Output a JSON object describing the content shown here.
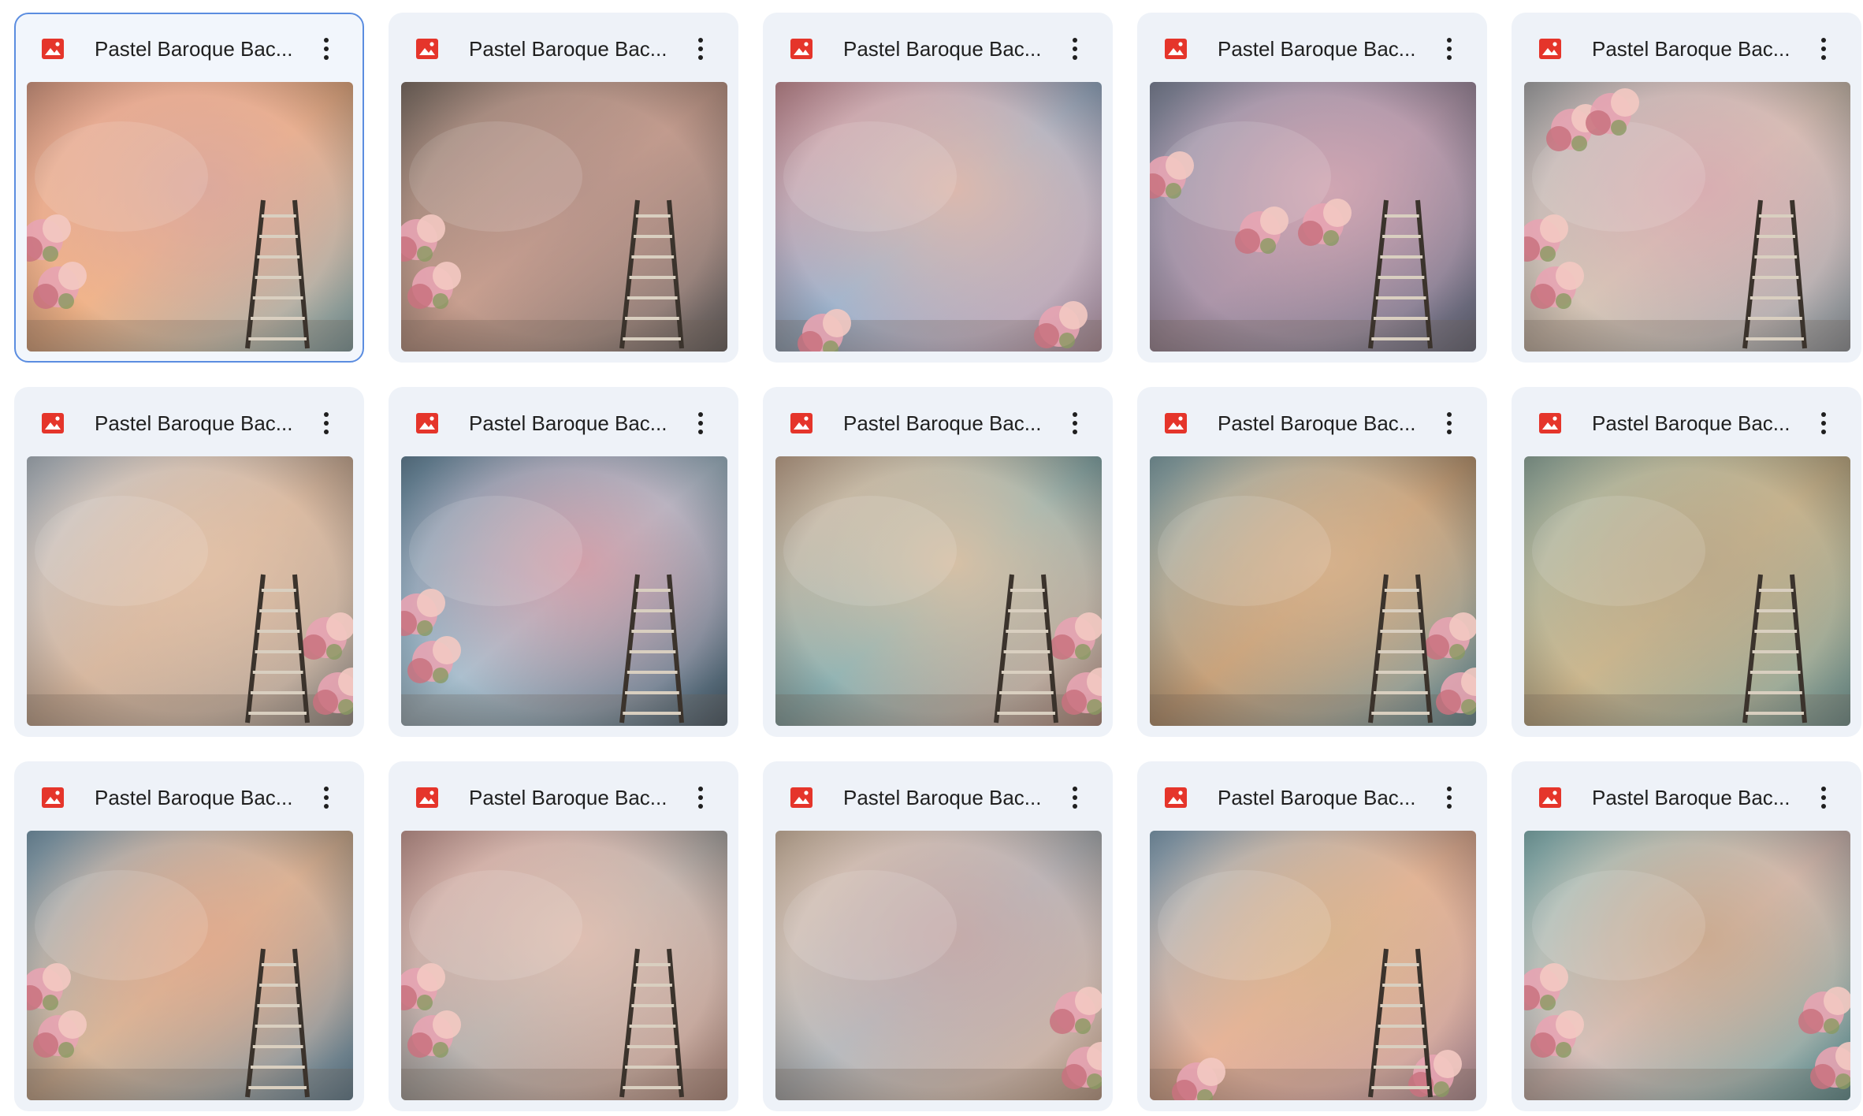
{
  "files": [
    {
      "title": "Pastel Baroque Bac...",
      "icon": "image-file-icon",
      "selected": true,
      "palette": [
        "#e8a890",
        "#f2b58a",
        "#8fb3b8",
        "#d8a7a0"
      ],
      "ladder": true,
      "flowers": "bottom-left"
    },
    {
      "title": "Pastel Baroque Bac...",
      "icon": "image-file-icon",
      "selected": false,
      "palette": [
        "#8a7a70",
        "#c9a090",
        "#6f6a6a",
        "#b5938a"
      ],
      "ladder": true,
      "flowers": "left"
    },
    {
      "title": "Pastel Baroque Bac...",
      "icon": "image-file-icon",
      "selected": false,
      "palette": [
        "#d89aa0",
        "#9fb5cf",
        "#c7a5b5",
        "#e6b9a8"
      ],
      "ladder": false,
      "flowers": "bottom"
    },
    {
      "title": "Pastel Baroque Bac...",
      "icon": "image-file-icon",
      "selected": false,
      "palette": [
        "#8c93a8",
        "#a994a8",
        "#6f7388",
        "#d7a9b4"
      ],
      "ladder": true,
      "flowers": "top"
    },
    {
      "title": "Pastel Baroque Bac...",
      "icon": "image-file-icon",
      "selected": false,
      "palette": [
        "#b7b6b8",
        "#d7c7b8",
        "#9fa7b0",
        "#d8a9b0"
      ],
      "ladder": true,
      "flowers": "top-left"
    },
    {
      "title": "Pastel Baroque Bac...",
      "icon": "image-file-icon",
      "selected": false,
      "palette": [
        "#bfc9d3",
        "#d6b79f",
        "#a9a19a",
        "#e3c2a8"
      ],
      "ladder": true,
      "flowers": "right"
    },
    {
      "title": "Pastel Baroque Bac...",
      "icon": "image-file-icon",
      "selected": false,
      "palette": [
        "#6f8fa5",
        "#a9c2d1",
        "#4e6475",
        "#d99aa3"
      ],
      "ladder": true,
      "flowers": "left"
    },
    {
      "title": "Pastel Baroque Bac...",
      "icon": "image-file-icon",
      "selected": false,
      "palette": [
        "#d5b59b",
        "#8fb4b5",
        "#c89e8f",
        "#e2c2a3"
      ],
      "ladder": true,
      "flowers": "right"
    },
    {
      "title": "Pastel Baroque Bac...",
      "icon": "image-file-icon",
      "selected": false,
      "palette": [
        "#8fb1b8",
        "#c7a17a",
        "#6f9aa6",
        "#d8b48f"
      ],
      "ladder": true,
      "flowers": "right"
    },
    {
      "title": "Pastel Baroque Bac...",
      "icon": "image-file-icon",
      "selected": false,
      "palette": [
        "#9fb9ac",
        "#cdb88f",
        "#7ea5a2",
        "#b9a88a"
      ],
      "ladder": true,
      "flowers": "none"
    },
    {
      "title": "Pastel Baroque Bac...",
      "icon": "image-file-icon",
      "selected": false,
      "palette": [
        "#86a9bf",
        "#d8b79a",
        "#6a8ea5",
        "#e1a98c"
      ],
      "ladder": true,
      "flowers": "left"
    },
    {
      "title": "Pastel Baroque Bac...",
      "icon": "image-file-icon",
      "selected": false,
      "palette": [
        "#d8a8a0",
        "#b7b3b0",
        "#c49a8c",
        "#e5c1b2"
      ],
      "ladder": true,
      "flowers": "bottom-left"
    },
    {
      "title": "Pastel Baroque Bac...",
      "icon": "image-file-icon",
      "selected": false,
      "palette": [
        "#e2c8b0",
        "#b8bcc0",
        "#d6b39c",
        "#c7a8a6"
      ],
      "ladder": false,
      "flowers": "right"
    },
    {
      "title": "Pastel Baroque Bac...",
      "icon": "image-file-icon",
      "selected": false,
      "palette": [
        "#8fb0c7",
        "#e8b49a",
        "#c6a0a8",
        "#d7b58e"
      ],
      "ladder": true,
      "flowers": "bottom"
    },
    {
      "title": "Pastel Baroque Bac...",
      "icon": "image-file-icon",
      "selected": false,
      "palette": [
        "#8fc2c2",
        "#d9c2bc",
        "#6aa3a6",
        "#c9a789"
      ],
      "ladder": false,
      "flowers": "bottom-sides"
    }
  ]
}
